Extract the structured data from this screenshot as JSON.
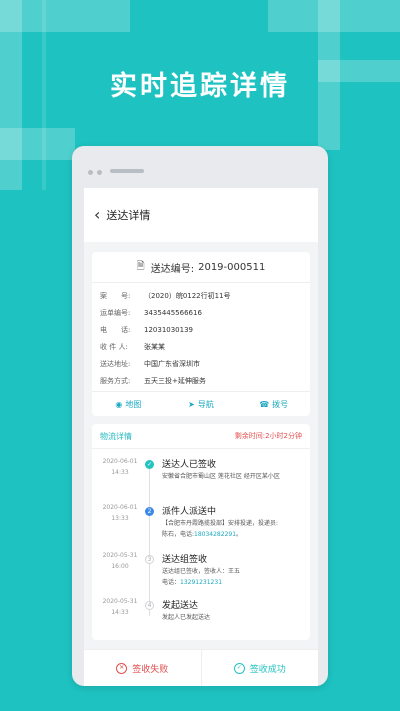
{
  "headline": "实时追踪详情",
  "nav": {
    "title": "送达详情"
  },
  "delivery": {
    "number_label": "送达编号:",
    "number": "2019-000511",
    "fields": [
      {
        "k": "案　　号:",
        "v": "（2020）皖0122行初11号"
      },
      {
        "k": "运单编号:",
        "v": "3435445566616"
      },
      {
        "k": "电　　话:",
        "v": "12031030139"
      },
      {
        "k": "收 件 人:",
        "v": "张某某"
      },
      {
        "k": "送达地址:",
        "v": "中国广东省深圳市"
      },
      {
        "k": "服务方式:",
        "v": "五天三投+延伸服务"
      }
    ],
    "actions": [
      {
        "label": "地图",
        "icon": "pin-icon"
      },
      {
        "label": "导航",
        "icon": "navigation-icon"
      },
      {
        "label": "拨号",
        "icon": "phone-icon"
      }
    ]
  },
  "logistics": {
    "title": "物流详情",
    "remain_label": "剩余时间:",
    "remain_value": "2小时2分钟",
    "steps": [
      {
        "date": "2020-06-01",
        "time": "14:33",
        "node": "✓",
        "title": "送达人已签收",
        "lines": [
          "安徽省合肥市蜀山区 莲花社区 经开区某小区"
        ]
      },
      {
        "date": "2020-06-01",
        "time": "13:33",
        "node": "2",
        "title": "派件人派送中",
        "lines": [
          "【合肥市丹霞路揽投部】安排投递，投递员:",
          "陈石，电话:",
          "18034282291",
          "。"
        ]
      },
      {
        "date": "2020-05-31",
        "time": "16:00",
        "node": "3",
        "title": "送达组签收",
        "lines": [
          "送达组已签收，签收人：王五",
          "电话：",
          "13291231231"
        ]
      },
      {
        "date": "2020-05-31",
        "time": "14:33",
        "node": "4",
        "title": "发起送达",
        "lines": [
          "发起人已发起送达"
        ]
      }
    ]
  },
  "buttons": {
    "fail": "签收失败",
    "success": "签收成功"
  }
}
